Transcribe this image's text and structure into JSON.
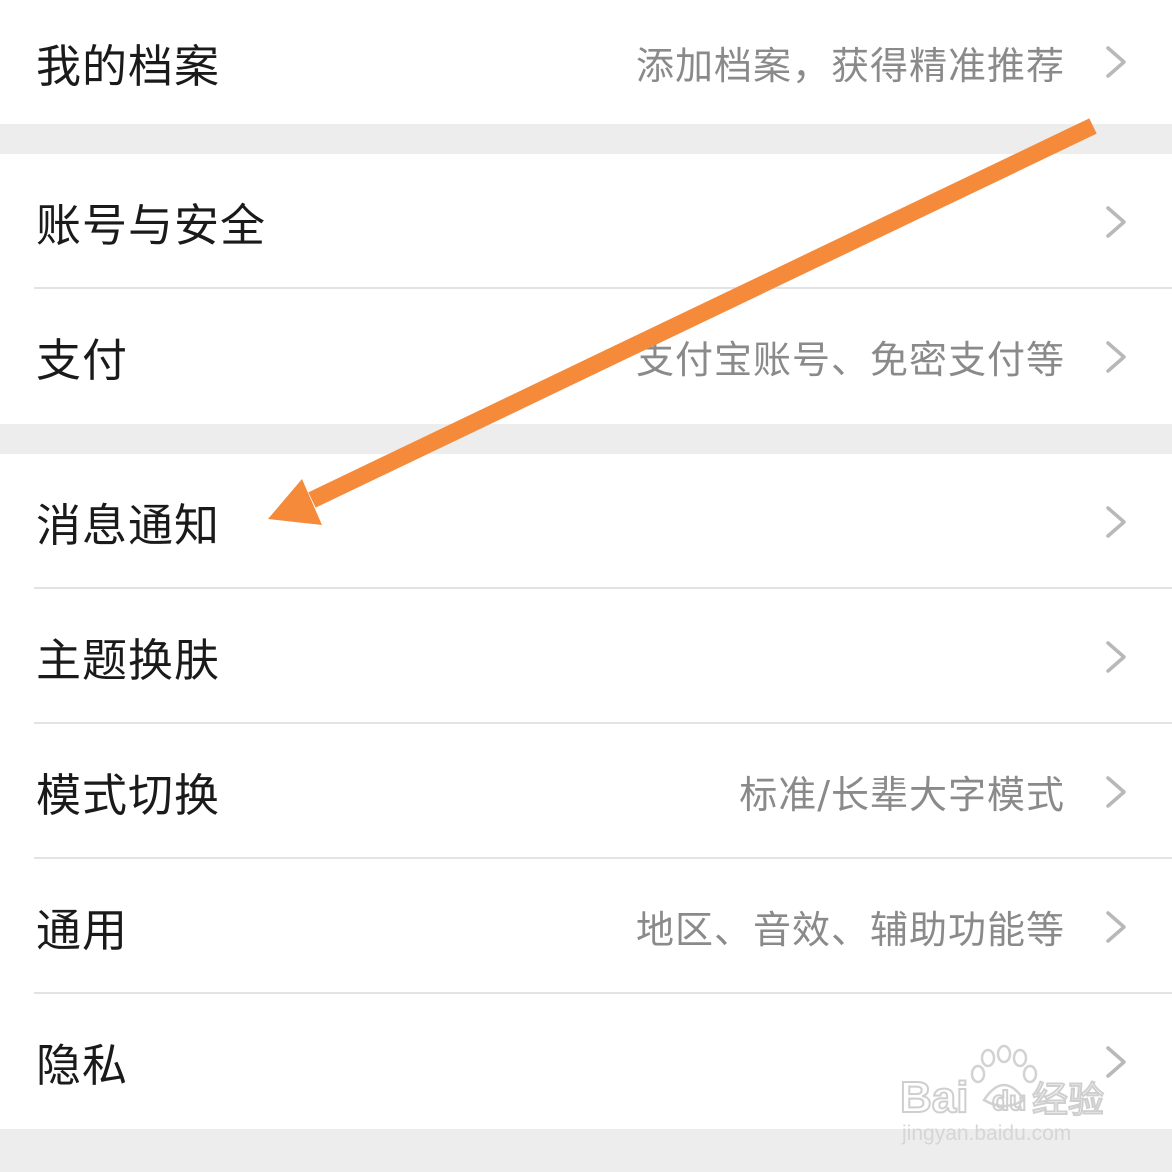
{
  "settings": {
    "items": [
      {
        "label": "我的档案",
        "hint": "添加档案，获得精准推荐"
      },
      {
        "label": "账号与安全",
        "hint": ""
      },
      {
        "label": "支付",
        "hint": "支付宝账号、免密支付等"
      },
      {
        "label": "消息通知",
        "hint": ""
      },
      {
        "label": "主题换肤",
        "hint": ""
      },
      {
        "label": "模式切换",
        "hint": "标准/长辈大字模式"
      },
      {
        "label": "通用",
        "hint": "地区、音效、辅助功能等"
      },
      {
        "label": "隐私",
        "hint": ""
      }
    ]
  },
  "annotation": {
    "arrow_color": "#f58a3b",
    "points_to": "消息通知"
  },
  "watermark": {
    "brand": "Bai du 经验",
    "url": "jingyan.baidu.com"
  },
  "colors": {
    "background": "#ededed",
    "row": "#ffffff",
    "label": "#1a1a1a",
    "hint": "#8a8a8a",
    "chevron": "#b8b8b8"
  }
}
